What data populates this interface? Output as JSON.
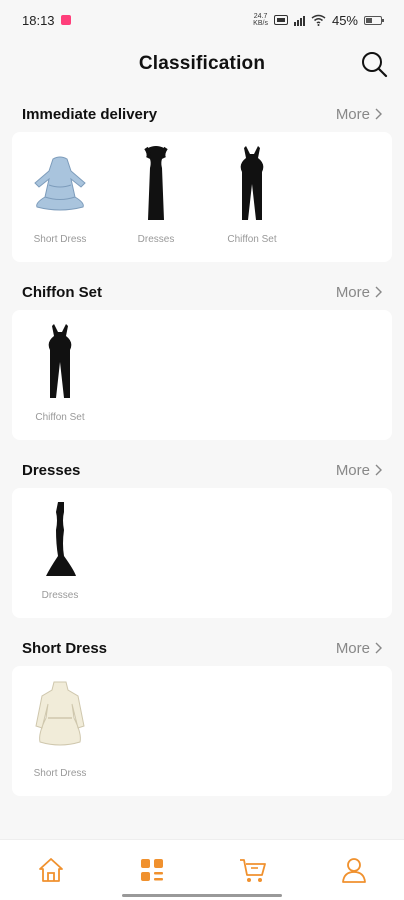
{
  "status_bar": {
    "time": "18:13",
    "net_speed_value": "24.7",
    "net_speed_unit": "KB/s",
    "battery_text": "45%",
    "battery_level": 0.45
  },
  "header": {
    "title": "Classification",
    "search_icon": "search-icon"
  },
  "sections": [
    {
      "title": "Immediate delivery",
      "more_label": "More",
      "items": [
        {
          "label": "Short Dress",
          "icon": "blue-short-dress"
        },
        {
          "label": "Dresses",
          "icon": "black-dress"
        },
        {
          "label": "Chiffon Set",
          "icon": "black-chiffon-set"
        }
      ]
    },
    {
      "title": "Chiffon Set",
      "more_label": "More",
      "items": [
        {
          "label": "Chiffon Set",
          "icon": "black-chiffon-set"
        }
      ]
    },
    {
      "title": "Dresses",
      "more_label": "More",
      "items": [
        {
          "label": "Dresses",
          "icon": "black-mermaid-dress"
        }
      ]
    },
    {
      "title": "Short Dress",
      "more_label": "More",
      "items": [
        {
          "label": "Short Dress",
          "icon": "cream-short-dress"
        }
      ]
    }
  ],
  "bottom_nav": [
    {
      "icon": "home-icon",
      "active": false
    },
    {
      "icon": "category-icon",
      "active": true
    },
    {
      "icon": "cart-icon",
      "active": false
    },
    {
      "icon": "profile-icon",
      "active": false
    }
  ],
  "colors": {
    "accent": "#f0912e",
    "background": "#f7f7f7",
    "card": "#ffffff",
    "muted_text": "#999999"
  }
}
